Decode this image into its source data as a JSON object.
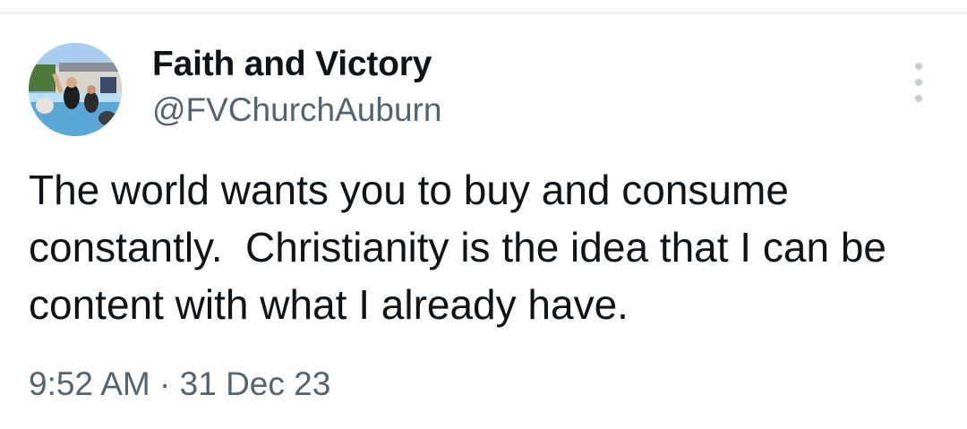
{
  "tweet": {
    "display_name": "Faith and Victory",
    "handle": "@FVChurchAuburn",
    "text": "The world wants you to buy and consume constantly.  Christianity is the idea that I can be content with what I already have.",
    "timestamp": "9:52 AM · 31 Dec 23",
    "more_icon": "more-vertical-icon"
  },
  "colors": {
    "text_primary": "#0f1419",
    "text_secondary": "#536471",
    "more_dots": "#c8cdd1",
    "divider": "#e6e6e6"
  }
}
